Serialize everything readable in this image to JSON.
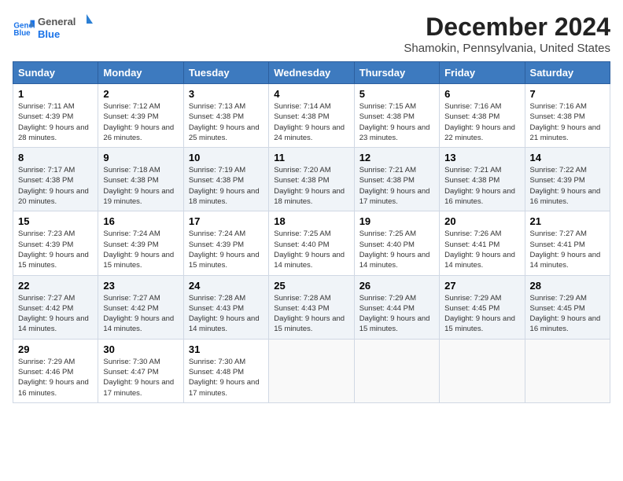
{
  "logo": {
    "line1": "General",
    "line2": "Blue"
  },
  "title": "December 2024",
  "subtitle": "Shamokin, Pennsylvania, United States",
  "headers": [
    "Sunday",
    "Monday",
    "Tuesday",
    "Wednesday",
    "Thursday",
    "Friday",
    "Saturday"
  ],
  "weeks": [
    [
      {
        "day": "1",
        "sunrise": "7:11 AM",
        "sunset": "4:39 PM",
        "daylight": "9 hours and 28 minutes."
      },
      {
        "day": "2",
        "sunrise": "7:12 AM",
        "sunset": "4:39 PM",
        "daylight": "9 hours and 26 minutes."
      },
      {
        "day": "3",
        "sunrise": "7:13 AM",
        "sunset": "4:38 PM",
        "daylight": "9 hours and 25 minutes."
      },
      {
        "day": "4",
        "sunrise": "7:14 AM",
        "sunset": "4:38 PM",
        "daylight": "9 hours and 24 minutes."
      },
      {
        "day": "5",
        "sunrise": "7:15 AM",
        "sunset": "4:38 PM",
        "daylight": "9 hours and 23 minutes."
      },
      {
        "day": "6",
        "sunrise": "7:16 AM",
        "sunset": "4:38 PM",
        "daylight": "9 hours and 22 minutes."
      },
      {
        "day": "7",
        "sunrise": "7:16 AM",
        "sunset": "4:38 PM",
        "daylight": "9 hours and 21 minutes."
      }
    ],
    [
      {
        "day": "8",
        "sunrise": "7:17 AM",
        "sunset": "4:38 PM",
        "daylight": "9 hours and 20 minutes."
      },
      {
        "day": "9",
        "sunrise": "7:18 AM",
        "sunset": "4:38 PM",
        "daylight": "9 hours and 19 minutes."
      },
      {
        "day": "10",
        "sunrise": "7:19 AM",
        "sunset": "4:38 PM",
        "daylight": "9 hours and 18 minutes."
      },
      {
        "day": "11",
        "sunrise": "7:20 AM",
        "sunset": "4:38 PM",
        "daylight": "9 hours and 18 minutes."
      },
      {
        "day": "12",
        "sunrise": "7:21 AM",
        "sunset": "4:38 PM",
        "daylight": "9 hours and 17 minutes."
      },
      {
        "day": "13",
        "sunrise": "7:21 AM",
        "sunset": "4:38 PM",
        "daylight": "9 hours and 16 minutes."
      },
      {
        "day": "14",
        "sunrise": "7:22 AM",
        "sunset": "4:39 PM",
        "daylight": "9 hours and 16 minutes."
      }
    ],
    [
      {
        "day": "15",
        "sunrise": "7:23 AM",
        "sunset": "4:39 PM",
        "daylight": "9 hours and 15 minutes."
      },
      {
        "day": "16",
        "sunrise": "7:24 AM",
        "sunset": "4:39 PM",
        "daylight": "9 hours and 15 minutes."
      },
      {
        "day": "17",
        "sunrise": "7:24 AM",
        "sunset": "4:39 PM",
        "daylight": "9 hours and 15 minutes."
      },
      {
        "day": "18",
        "sunrise": "7:25 AM",
        "sunset": "4:40 PM",
        "daylight": "9 hours and 14 minutes."
      },
      {
        "day": "19",
        "sunrise": "7:25 AM",
        "sunset": "4:40 PM",
        "daylight": "9 hours and 14 minutes."
      },
      {
        "day": "20",
        "sunrise": "7:26 AM",
        "sunset": "4:41 PM",
        "daylight": "9 hours and 14 minutes."
      },
      {
        "day": "21",
        "sunrise": "7:27 AM",
        "sunset": "4:41 PM",
        "daylight": "9 hours and 14 minutes."
      }
    ],
    [
      {
        "day": "22",
        "sunrise": "7:27 AM",
        "sunset": "4:42 PM",
        "daylight": "9 hours and 14 minutes."
      },
      {
        "day": "23",
        "sunrise": "7:27 AM",
        "sunset": "4:42 PM",
        "daylight": "9 hours and 14 minutes."
      },
      {
        "day": "24",
        "sunrise": "7:28 AM",
        "sunset": "4:43 PM",
        "daylight": "9 hours and 14 minutes."
      },
      {
        "day": "25",
        "sunrise": "7:28 AM",
        "sunset": "4:43 PM",
        "daylight": "9 hours and 15 minutes."
      },
      {
        "day": "26",
        "sunrise": "7:29 AM",
        "sunset": "4:44 PM",
        "daylight": "9 hours and 15 minutes."
      },
      {
        "day": "27",
        "sunrise": "7:29 AM",
        "sunset": "4:45 PM",
        "daylight": "9 hours and 15 minutes."
      },
      {
        "day": "28",
        "sunrise": "7:29 AM",
        "sunset": "4:45 PM",
        "daylight": "9 hours and 16 minutes."
      }
    ],
    [
      {
        "day": "29",
        "sunrise": "7:29 AM",
        "sunset": "4:46 PM",
        "daylight": "9 hours and 16 minutes."
      },
      {
        "day": "30",
        "sunrise": "7:30 AM",
        "sunset": "4:47 PM",
        "daylight": "9 hours and 17 minutes."
      },
      {
        "day": "31",
        "sunrise": "7:30 AM",
        "sunset": "4:48 PM",
        "daylight": "9 hours and 17 minutes."
      },
      null,
      null,
      null,
      null
    ]
  ]
}
